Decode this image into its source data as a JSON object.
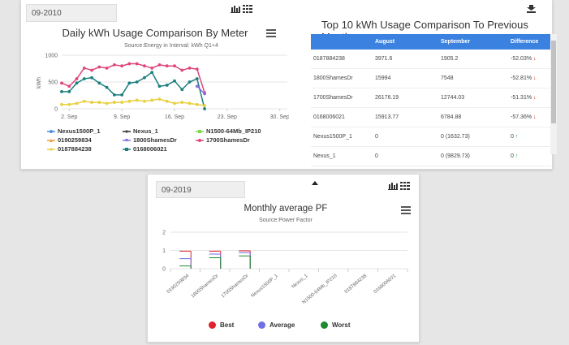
{
  "top": {
    "date_value": "09-2010",
    "download_icon": "download-icon",
    "chart": {
      "title": "Daily kWh Usage Comparison By Meter",
      "subtitle": "Source:Energy in Interval: kWh Q1+4",
      "ylabel": "kWh",
      "yticks": [
        "1000",
        "500",
        "0"
      ],
      "xticks": [
        "2. Sep",
        "9. Sep",
        "16. Sep",
        "23. Sep",
        "30. Sep"
      ]
    },
    "legend": [
      {
        "name": "Nexus1500P_1",
        "color": "#4a90e2"
      },
      {
        "name": "Nexus_1",
        "color": "#222222"
      },
      {
        "name": "N1500-64Mb_IP210",
        "color": "#7ed957"
      },
      {
        "name": "0190259834",
        "color": "#f0a040"
      },
      {
        "name": "1800ShamesDr",
        "color": "#8a6ee0"
      },
      {
        "name": "1700ShamesDr",
        "color": "#e0457b"
      },
      {
        "name": "0187884238",
        "color": "#e8d040"
      },
      {
        "name": "0168006021",
        "color": "#1f7f7f"
      }
    ],
    "table": {
      "title": "Top 10 kWh Usage Comparison To Previous Month",
      "headers": [
        "",
        "August",
        "September",
        "Difference"
      ],
      "rows": [
        {
          "meter": "0187884238",
          "aug": "3971.6",
          "sep": "1905.2",
          "diff": "-52.03%",
          "dir": "down"
        },
        {
          "meter": "1800ShamesDr",
          "aug": "15994",
          "sep": "7548",
          "diff": "-52.81%",
          "dir": "down"
        },
        {
          "meter": "1700ShamesDr",
          "aug": "26176.19",
          "sep": "12744.03",
          "diff": "-51.31%",
          "dir": "down"
        },
        {
          "meter": "0168006021",
          "aug": "15913.77",
          "sep": "6784.88",
          "diff": "-57.36%",
          "dir": "down"
        },
        {
          "meter": "Nexus1500P_1",
          "aug": "0",
          "sep": "0 (1632.73)",
          "diff": "0",
          "dir": "up"
        },
        {
          "meter": "Nexus_1",
          "aug": "0",
          "sep": "0 (9829.73)",
          "diff": "0",
          "dir": "up"
        }
      ]
    }
  },
  "chart_data": [
    {
      "type": "line",
      "title": "Daily kWh Usage Comparison By Meter",
      "subtitle": "Source:Energy in Interval: kWh Q1+4",
      "ylabel": "kWh",
      "ylim": [
        0,
        1000
      ],
      "x_start": "1. Sep",
      "series": [
        {
          "name": "1700ShamesDr",
          "color": "#e0457b",
          "values": [
            480,
            420,
            560,
            760,
            720,
            780,
            760,
            820,
            800,
            840,
            840,
            800,
            760,
            820,
            800,
            800,
            720,
            760,
            740,
            300
          ]
        },
        {
          "name": "0168006021",
          "color": "#1f7f7f",
          "values": [
            320,
            320,
            480,
            560,
            580,
            480,
            400,
            260,
            260,
            480,
            500,
            580,
            680,
            420,
            440,
            520,
            360,
            500,
            560,
            0
          ]
        },
        {
          "name": "0187884238",
          "color": "#e8d040",
          "values": [
            80,
            80,
            100,
            140,
            120,
            120,
            100,
            120,
            120,
            140,
            160,
            140,
            160,
            180,
            140,
            100,
            120,
            100,
            80,
            60
          ]
        },
        {
          "name": "1800ShamesDr",
          "color": "#8a6ee0",
          "values": [
            null,
            null,
            null,
            null,
            null,
            null,
            null,
            null,
            null,
            null,
            null,
            null,
            null,
            null,
            null,
            null,
            null,
            null,
            420,
            280
          ]
        }
      ]
    },
    {
      "type": "bar",
      "title": "Monthly average PF",
      "subtitle": "Source:Power Factor",
      "ylim": [
        0,
        2
      ],
      "categories": [
        "0190259834",
        "1800ShamesDr",
        "1700ShamesDr",
        "Nexus1500P_1",
        "Nexus_1",
        "N1500-64Mb_IP210",
        "0187884238",
        "0168006021"
      ],
      "series": [
        {
          "name": "Best",
          "color": "#e0202b",
          "values": [
            0.96,
            0.96,
            0.98,
            0,
            0,
            0,
            0,
            0
          ]
        },
        {
          "name": "Average",
          "color": "#6f6fe8",
          "values": [
            0.55,
            0.8,
            0.88,
            0,
            0,
            0,
            0,
            0
          ]
        },
        {
          "name": "Worst",
          "color": "#1e8a2e",
          "values": [
            0.15,
            0.6,
            0.7,
            0,
            0,
            0,
            0,
            0
          ]
        }
      ]
    }
  ],
  "bottom": {
    "date_value": "09-2019",
    "chart": {
      "title": "Monthly average PF",
      "subtitle": "Source:Power Factor",
      "yticks": [
        "2",
        "1",
        "0"
      ]
    },
    "legend": [
      {
        "name": "Best",
        "color": "#e0202b"
      },
      {
        "name": "Average",
        "color": "#6f6fe8"
      },
      {
        "name": "Worst",
        "color": "#1e8a2e"
      }
    ]
  }
}
